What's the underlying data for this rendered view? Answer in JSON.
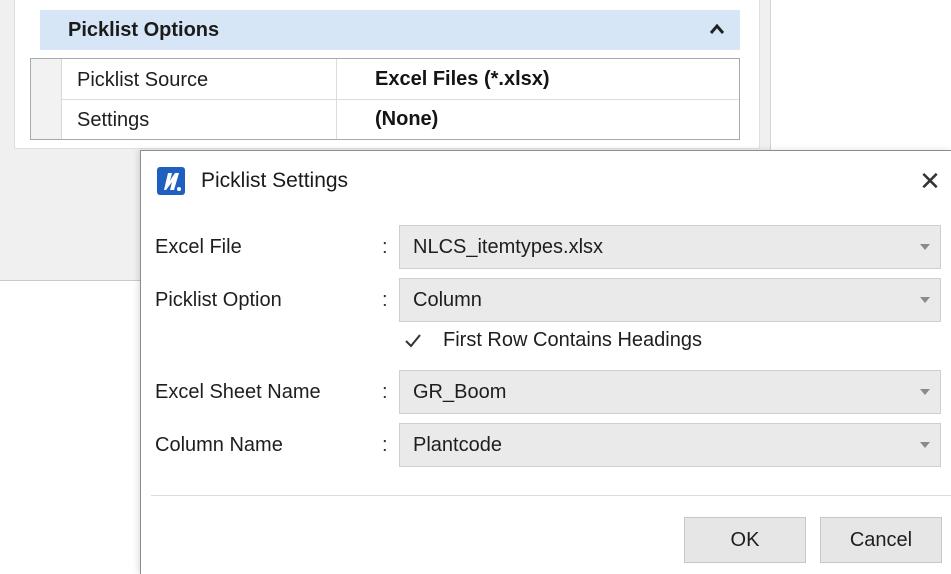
{
  "panel": {
    "group_title": "Picklist Options",
    "collapse_icon": "chevron-up-icon",
    "properties": [
      {
        "name": "Picklist Source",
        "value": "Excel Files (*.xlsx)"
      },
      {
        "name": "Settings",
        "value": "(None)"
      }
    ]
  },
  "dialog": {
    "app_icon": "microstation-logo-icon",
    "title": "Picklist Settings",
    "close_label": "✕",
    "fields": [
      {
        "label": "Excel File",
        "colon": ":",
        "value": "NLCS_itemtypes.xlsx"
      },
      {
        "label": "Picklist Option",
        "colon": ":",
        "value": "Column"
      },
      {
        "label": "Excel Sheet Name",
        "colon": ":",
        "value": "GR_Boom"
      },
      {
        "label": "Column Name",
        "colon": ":",
        "value": "Plantcode"
      }
    ],
    "checkbox": {
      "label": "First Row Contains Headings",
      "checked": true
    },
    "ok_label": "OK",
    "cancel_label": "Cancel"
  },
  "colors": {
    "group_header": "#d7e6f6",
    "logo_blue": "#1f5fbf",
    "combo_bg": "#eaeaea",
    "button_bg": "#e6e6e6"
  }
}
